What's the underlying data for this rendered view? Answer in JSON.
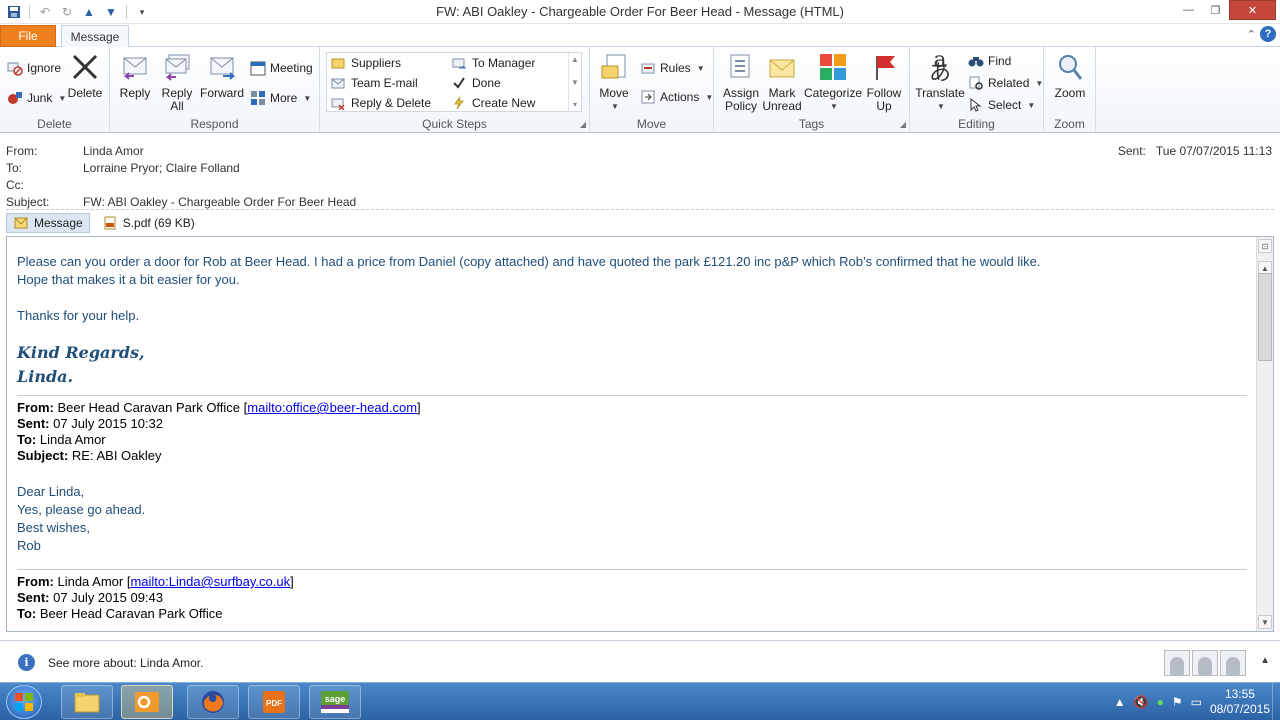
{
  "window": {
    "title": "FW: ABI Oakley - Chargeable Order For Beer Head  -  Message (HTML)"
  },
  "tabs": {
    "file": "File",
    "message": "Message"
  },
  "ribbon": {
    "delete_group": {
      "label": "Delete",
      "ignore": "Ignore",
      "junk": "Junk",
      "delete": "Delete"
    },
    "respond_group": {
      "label": "Respond",
      "reply": "Reply",
      "reply_all_1": "Reply",
      "reply_all_2": "All",
      "forward": "Forward",
      "meeting": "Meeting",
      "more": "More"
    },
    "quick_steps": {
      "label": "Quick Steps",
      "items": [
        "Suppliers",
        "To Manager",
        "Team E-mail",
        "Done",
        "Reply & Delete",
        "Create New"
      ]
    },
    "move_group": {
      "label": "Move",
      "move": "Move",
      "rules": "Rules",
      "actions": "Actions"
    },
    "tags_group": {
      "label": "Tags",
      "assign_1": "Assign",
      "assign_2": "Policy",
      "mark_1": "Mark",
      "mark_2": "Unread",
      "categorize": "Categorize",
      "follow_1": "Follow",
      "follow_2": "Up"
    },
    "editing_group": {
      "label": "Editing",
      "translate": "Translate",
      "find": "Find",
      "related": "Related",
      "select": "Select"
    },
    "zoom_group": {
      "label": "Zoom",
      "zoom": "Zoom"
    }
  },
  "header": {
    "from_label": "From:",
    "from": "Linda Amor",
    "to_label": "To:",
    "to": "Lorraine Pryor; Claire Folland",
    "cc_label": "Cc:",
    "cc": "",
    "subject_label": "Subject:",
    "subject": "FW: ABI Oakley - Chargeable Order For Beer Head",
    "sent_label": "Sent:",
    "sent": "Tue 07/07/2015 11:13"
  },
  "attachments": {
    "message_tab": "Message",
    "file": "S.pdf (69 KB)"
  },
  "body": {
    "line1": "Please can you order a door for Rob at Beer Head.  I had a price from Daniel (copy attached) and have quoted the park £121.20 inc p&P which Rob’s confirmed that he would like.",
    "line2": "Hope that makes it a bit easier for you.",
    "line3": "Thanks for your help.",
    "sig1": "Kind Regards,",
    "sig2": "Linda.",
    "q1": {
      "from_label": "From:",
      "from": "Beer Head Caravan Park Office [",
      "from_link": "mailto:office@beer-head.com",
      "from_end": "]",
      "sent_label": "Sent:",
      "sent": "07 July 2015 10:32",
      "to_label": "To:",
      "to": "Linda Amor",
      "subject_label": "Subject:",
      "subject": "RE: ABI Oakley",
      "l1": "Dear Linda,",
      "l2": "Yes, please go ahead.",
      "l3": "Best wishes,",
      "l4": "Rob"
    },
    "q2": {
      "from_label": "From:",
      "from": "Linda Amor [",
      "from_link": "mailto:Linda@surfbay.co.uk",
      "from_end": "]",
      "sent_label": "Sent:",
      "sent": "07 July 2015 09:43",
      "to_label": "To:",
      "to": "Beer Head Caravan Park Office"
    }
  },
  "people_pane": {
    "text": "See more about: Linda Amor."
  },
  "taskbar": {
    "time": "13:55",
    "date": "08/07/2015"
  },
  "colors": {
    "accent": "#f0801e",
    "body_text": "#1f4e79",
    "close": "#c7463b"
  }
}
